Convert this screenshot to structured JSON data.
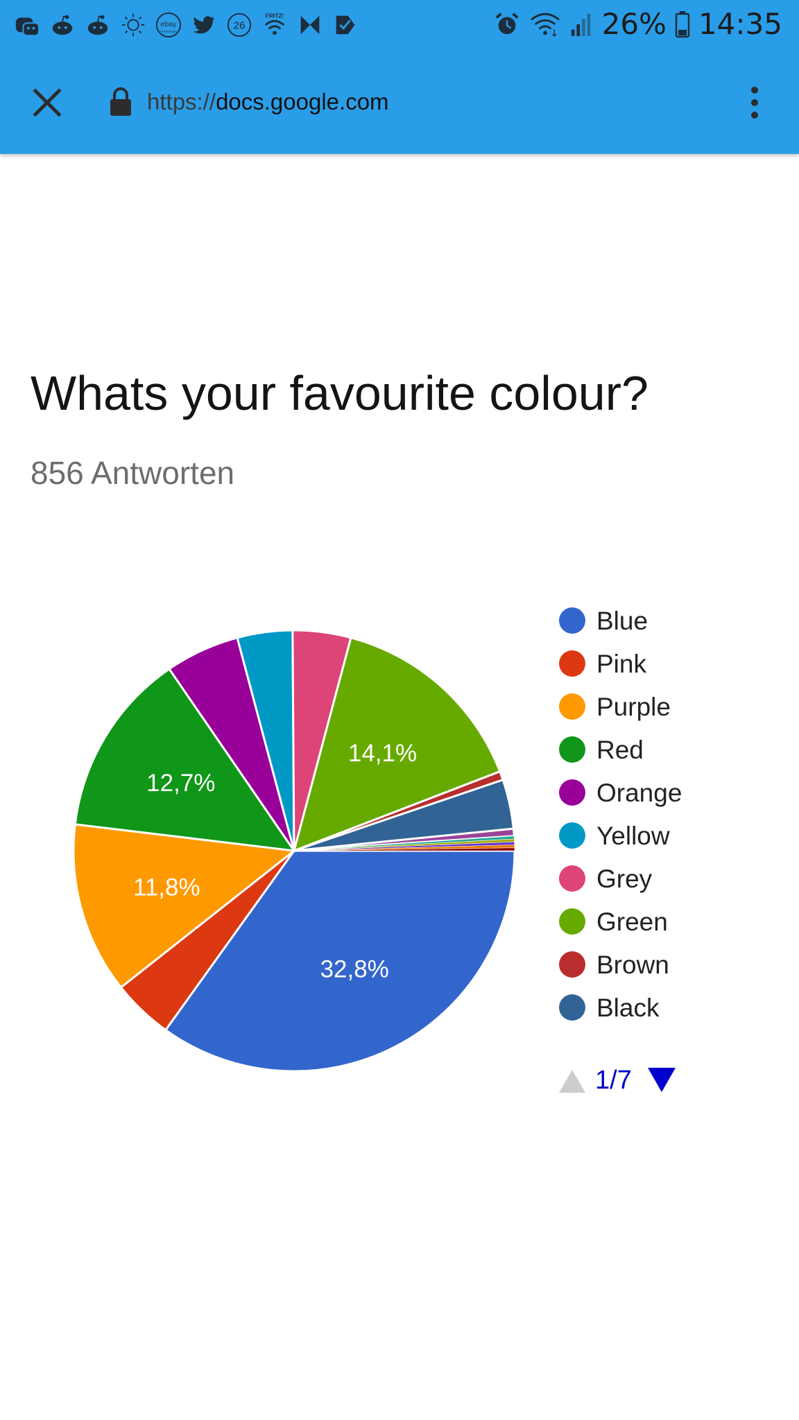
{
  "status_bar": {
    "icons": [
      "discord-icon",
      "reddit-icon",
      "reddit-icon",
      "weather-icon",
      "ebay-kleinanzeigen-icon",
      "twitter-icon",
      "badge-26-icon",
      "fritz-wifi-icon",
      "dazn-icon",
      "todo-check-icon"
    ],
    "badge_number": "26",
    "fritz_text": "FRITZ!",
    "ebay_text": "ebay",
    "ebay_subtext": "Kleinanzeigen",
    "right_icons": [
      "alarm-icon",
      "wifi-icon",
      "signal-icon",
      "battery-icon"
    ],
    "battery_percent": "26%",
    "time": "14:35"
  },
  "browser": {
    "url_scheme": "https://",
    "url_host": "docs.google.com",
    "close_icon": "close-icon",
    "lock_icon": "lock-icon",
    "menu_icon": "more-vert-icon"
  },
  "form": {
    "question": "Whats your favourite colour?",
    "responses": "856 Antworten"
  },
  "chart_data": {
    "type": "pie",
    "title": "",
    "slices": [
      {
        "label": "Blue",
        "percent": 32.8,
        "color": "#3366cc",
        "label_text": "32,8%"
      },
      {
        "label": "Pink",
        "percent": 4.2,
        "color": "#dc3912",
        "label_text": ""
      },
      {
        "label": "Purple",
        "percent": 11.8,
        "color": "#ff9900",
        "label_text": "11,8%"
      },
      {
        "label": "Red",
        "percent": 12.7,
        "color": "#109618",
        "label_text": "12,7%"
      },
      {
        "label": "Orange",
        "percent": 5.1,
        "color": "#990099",
        "label_text": ""
      },
      {
        "label": "Yellow",
        "percent": 3.8,
        "color": "#0099c6",
        "label_text": ""
      },
      {
        "label": "Grey",
        "percent": 4.0,
        "color": "#dd4477",
        "label_text": ""
      },
      {
        "label": "Green",
        "percent": 14.1,
        "color": "#66aa00",
        "label_text": "14,1%"
      },
      {
        "label": "Brown",
        "percent": 0.6,
        "color": "#b82e2e",
        "label_text": ""
      },
      {
        "label": "Black",
        "percent": 3.4,
        "color": "#316395",
        "label_text": ""
      },
      {
        "label": "",
        "percent": 0.5,
        "color": "#994499",
        "label_text": ""
      },
      {
        "label": "",
        "percent": 0.2,
        "color": "#22aa99",
        "label_text": ""
      },
      {
        "label": "",
        "percent": 0.2,
        "color": "#aaaa11",
        "label_text": ""
      },
      {
        "label": "",
        "percent": 0.2,
        "color": "#6633cc",
        "label_text": ""
      },
      {
        "label": "",
        "percent": 0.2,
        "color": "#e67300",
        "label_text": ""
      },
      {
        "label": "",
        "percent": 0.2,
        "color": "#8b0707",
        "label_text": ""
      }
    ],
    "legend": {
      "placement": "right",
      "entries": [
        "Blue",
        "Pink",
        "Purple",
        "Red",
        "Orange",
        "Yellow",
        "Grey",
        "Green",
        "Brown",
        "Black"
      ],
      "page": "1/7",
      "nav_color": "#0000cc",
      "nav_disabled_color": "#cccccc"
    }
  }
}
